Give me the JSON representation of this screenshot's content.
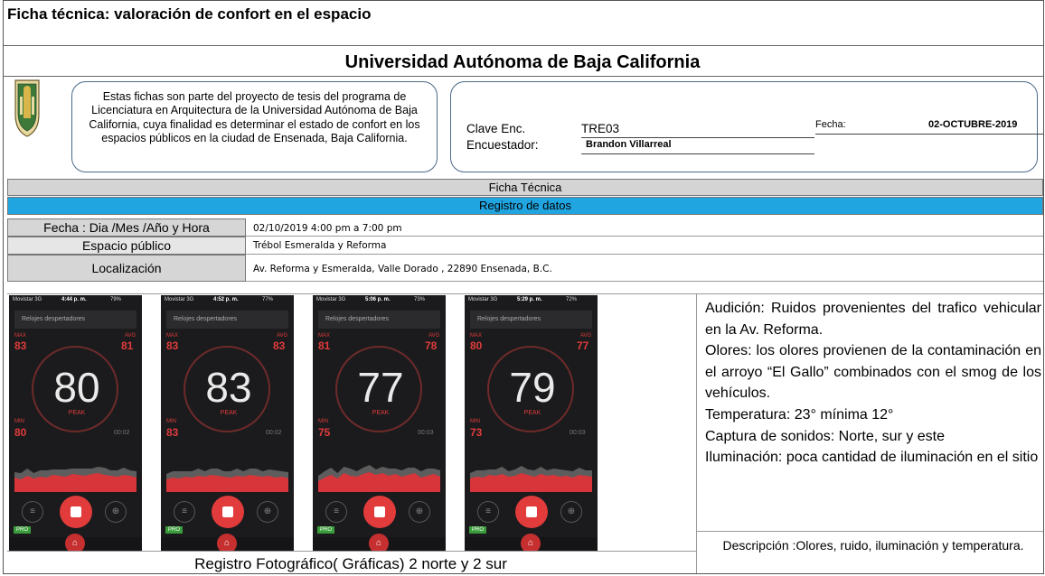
{
  "header": {
    "title": "Ficha técnica: valoración de confort en el espacio",
    "university": "Universidad Autónoma de Baja California"
  },
  "intro": {
    "text": "Estas fichas son parte del proyecto de tesis del programa de Licenciatura en Arquitectura de la Universidad Autónoma de Baja California,  cuya finalidad es determinar el estado de confort en los espacios públicos en la ciudad de Ensenada, Baja California."
  },
  "info": {
    "clave_label": "Clave Enc.",
    "clave_value": "TRE03",
    "encuestador_label": "Encuestador:",
    "encuestador_value": "Brandon Villarreal",
    "fecha_label": "Fecha:",
    "fecha_value": "02-OCTUBRE-2019"
  },
  "sections": {
    "ficha": "Ficha Técnica",
    "registro": "Registro de datos"
  },
  "rows": [
    {
      "label": "Fecha : Dia /Mes /Año  y Hora",
      "value": "02/10/2019 4:00 pm a 7:00 pm"
    },
    {
      "label": "Espacio público",
      "value": "Trébol Esmeralda y Reforma"
    },
    {
      "label": "Localización",
      "value": "Av. Reforma y Esmeralda, Valle Dorado , 22890 Ensenada, B.C."
    }
  ],
  "phones": [
    {
      "time": "4:44 p. m.",
      "carrier": "Movistar  3G",
      "battery": "79%",
      "app": "Relojes despertadores",
      "max_label": "MAX",
      "max": "83",
      "avg_label": "AVG",
      "avg": "81",
      "peak_value": "80",
      "peak_label": "PEAK",
      "min_label": "MIN",
      "min": "80",
      "duration": "00:02",
      "pro": "PRO"
    },
    {
      "time": "4:52 p. m.",
      "carrier": "Movistar  3G",
      "battery": "77%",
      "app": "Relojes despertadores",
      "max_label": "MAX",
      "max": "83",
      "avg_label": "AVG",
      "avg": "83",
      "peak_value": "83",
      "peak_label": "PEAK",
      "min_label": "MIN",
      "min": "83",
      "duration": "00:02",
      "pro": "PRO"
    },
    {
      "time": "5:06 p. m.",
      "carrier": "Movistar  3G",
      "battery": "73%",
      "app": "Relojes despertadores",
      "max_label": "MAX",
      "max": "81",
      "avg_label": "AVG",
      "avg": "78",
      "peak_value": "77",
      "peak_label": "PEAK",
      "min_label": "MIN",
      "min": "75",
      "duration": "00:03",
      "pro": "PRO"
    },
    {
      "time": "5:29 p. m.",
      "carrier": "Movistar  3G",
      "battery": "72%",
      "app": "Relojes despertadores",
      "max_label": "MAX",
      "max": "80",
      "avg_label": "AVG",
      "avg": "77",
      "peak_value": "79",
      "peak_label": "PEAK",
      "min_label": "MIN",
      "min": "73",
      "duration": "00:03",
      "pro": "PRO"
    }
  ],
  "notes": [
    "Audición:  Ruidos  provenientes  del trafico vehicular en la Av. Reforma.",
    "Olores:  los olores provienen de la contaminación en el arroyo “El Gallo” combinados  con  el  smog  de  los vehículos.",
    "Temperatura: 23° mínima 12°",
    "Captura de sonidos: Norte, sur y este",
    "Iluminación:    poca    cantidad    de iluminación en el sitio"
  ],
  "description": "Descripción :Olores, ruido, iluminación y temperatura.",
  "caption": "Registro Fotográfico( Gráficas) 2 norte y 2 sur",
  "colors": {
    "registro_bg": "#21a5e0",
    "gray_row": "#d6d6d6",
    "accent_red": "#e23b3b"
  }
}
